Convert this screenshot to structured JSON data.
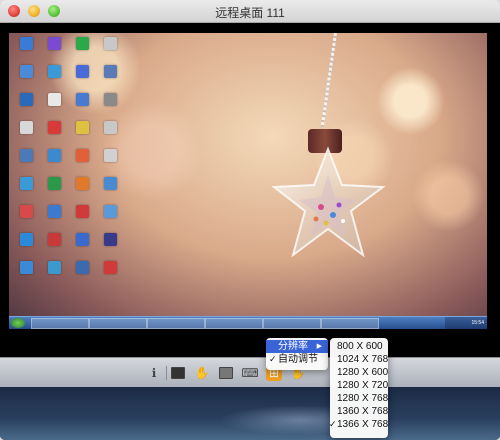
{
  "window": {
    "title": "远程桌面  111"
  },
  "desktop": {
    "icons": [
      {
        "label": "",
        "color": "#3a7bd5"
      },
      {
        "label": "",
        "color": "#7a4ad0"
      },
      {
        "label": "",
        "color": "#2aa84a"
      },
      {
        "label": "",
        "color": "#c8c8c8"
      },
      {
        "label": "",
        "color": "#4a8ad8"
      },
      {
        "label": "",
        "color": "#3a9ad8"
      },
      {
        "label": "",
        "color": "#4a6ad8"
      },
      {
        "label": "",
        "color": "#5a7ab8"
      },
      {
        "label": "",
        "color": "#2a6ab8"
      },
      {
        "label": "",
        "color": "#e8e8e8"
      },
      {
        "label": "",
        "color": "#4a7ad0"
      },
      {
        "label": "",
        "color": "#8a8a8a"
      },
      {
        "label": "",
        "color": "#d8d8d8"
      },
      {
        "label": "",
        "color": "#d83a3a"
      },
      {
        "label": "",
        "color": "#e0c040"
      },
      {
        "label": "",
        "color": "#c8c8c8"
      },
      {
        "label": "",
        "color": "#4a7ab8"
      },
      {
        "label": "",
        "color": "#3a8ad0"
      },
      {
        "label": "",
        "color": "#e0603a"
      },
      {
        "label": "",
        "color": "#d0d0d0"
      },
      {
        "label": "",
        "color": "#3a9ad8"
      },
      {
        "label": "",
        "color": "#2a9a4a"
      },
      {
        "label": "",
        "color": "#e07a2a"
      },
      {
        "label": "",
        "color": "#4a8ad0"
      },
      {
        "label": "",
        "color": "#d84a4a"
      },
      {
        "label": "",
        "color": "#3a7ad0"
      },
      {
        "label": "",
        "color": "#d03a3a"
      },
      {
        "label": "",
        "color": "#5a9ad8"
      },
      {
        "label": "",
        "color": "#2a8ad8"
      },
      {
        "label": "",
        "color": "#c83a3a"
      },
      {
        "label": "",
        "color": "#3a6ad0"
      },
      {
        "label": "",
        "color": "#3a3a8a"
      },
      {
        "label": "",
        "color": "#3a8ad8"
      },
      {
        "label": "",
        "color": "#3a9ad0"
      },
      {
        "label": "",
        "color": "#3a6ab0"
      },
      {
        "label": "",
        "color": "#d03a3a"
      }
    ]
  },
  "taskbar": {
    "tasks": [
      {
        "label": ""
      },
      {
        "label": ""
      },
      {
        "label": ""
      },
      {
        "label": ""
      },
      {
        "label": ""
      },
      {
        "label": ""
      }
    ],
    "clock": "15:54"
  },
  "toolbar": {
    "buttons": [
      {
        "name": "info-icon",
        "glyph": "ℹ"
      },
      {
        "name": "fullscreen-icon",
        "glyph": ""
      },
      {
        "name": "hand-icon",
        "glyph": "✋"
      },
      {
        "name": "screen-icon",
        "glyph": ""
      },
      {
        "name": "keyboard-icon",
        "glyph": "⌨"
      },
      {
        "name": "resolution-icon",
        "glyph": "⊞"
      },
      {
        "name": "gesture-icon",
        "glyph": "✋"
      }
    ]
  },
  "menu_left": {
    "items": [
      {
        "label": "分辨率",
        "highlight": true,
        "checked": false,
        "submenu": true
      },
      {
        "label": "自动调节",
        "highlight": false,
        "checked": true,
        "submenu": false
      }
    ]
  },
  "menu_right": {
    "items": [
      {
        "label": "800 X 600",
        "checked": false
      },
      {
        "label": "1024 X 768",
        "checked": false
      },
      {
        "label": "1280 X 600",
        "checked": false
      },
      {
        "label": "1280 X 720",
        "checked": false
      },
      {
        "label": "1280 X 768",
        "checked": false
      },
      {
        "label": "1360 X 768",
        "checked": false
      },
      {
        "label": "1366 X 768",
        "checked": true
      }
    ]
  }
}
